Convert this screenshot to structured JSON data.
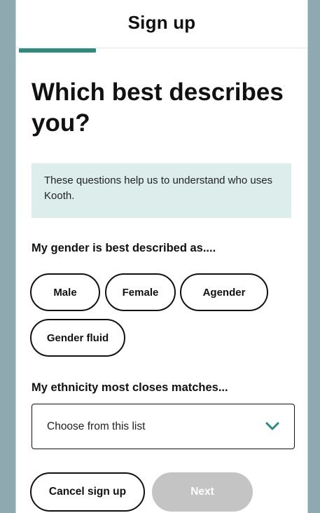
{
  "header": {
    "title": "Sign up",
    "progress_fraction": 0.25
  },
  "page": {
    "heading": "Which best describes you?",
    "info": "These questions help us to understand who uses Kooth."
  },
  "gender": {
    "label": "My gender is best described as....",
    "options": [
      "Male",
      "Female",
      "Agender",
      "Gender fluid"
    ]
  },
  "ethnicity": {
    "label": "My ethnicity most closes matches...",
    "placeholder": "Choose from this list"
  },
  "actions": {
    "cancel_label": "Cancel sign up",
    "next_label": "Next"
  },
  "colors": {
    "accent": "#2d8a7f",
    "info_bg": "#dcedec",
    "disabled": "#c4c4c4",
    "backdrop": "#8ea9b0"
  }
}
